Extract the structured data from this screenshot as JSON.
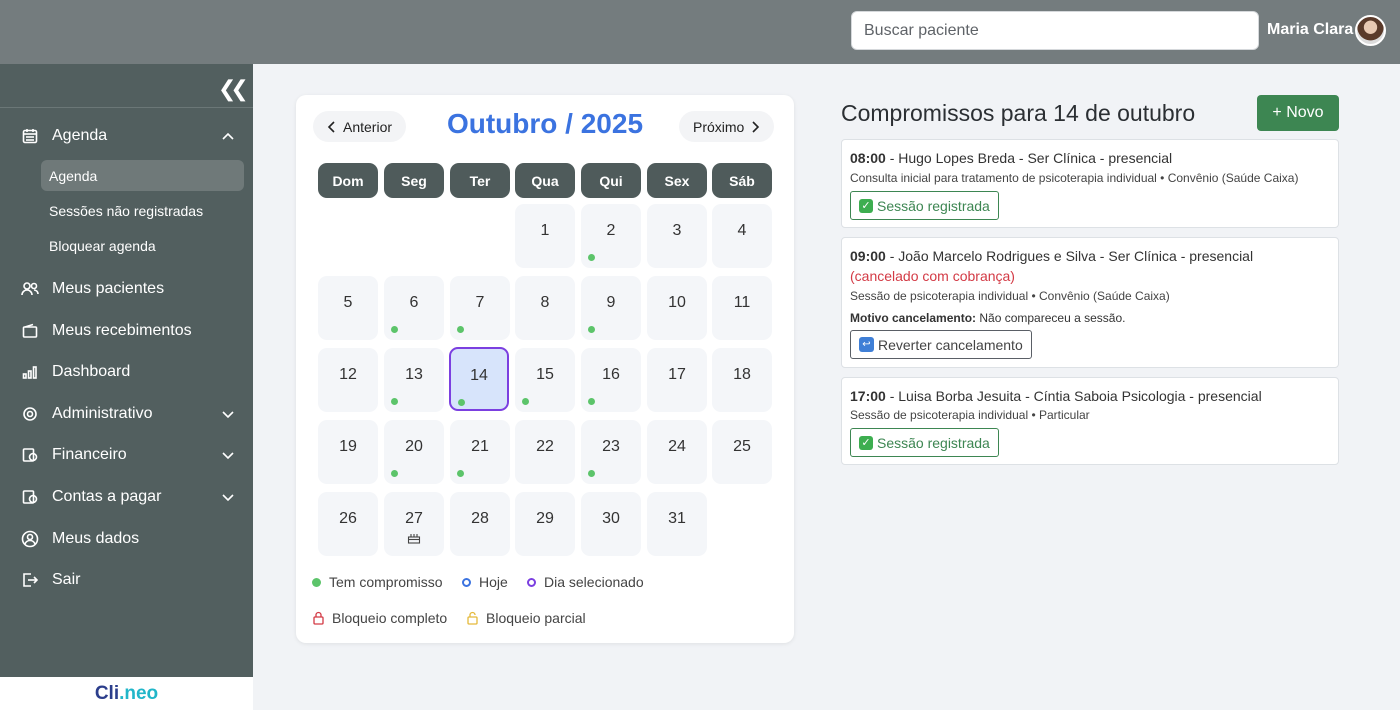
{
  "header": {
    "search_placeholder": "Buscar paciente",
    "user_name": "Maria Clara"
  },
  "sidebar": {
    "items": [
      {
        "label": "Agenda",
        "icon": "calendar-icon",
        "expanded": true
      },
      {
        "label": "Meus pacientes",
        "icon": "users-icon"
      },
      {
        "label": "Meus recebimentos",
        "icon": "wallet-icon"
      },
      {
        "label": "Dashboard",
        "icon": "bar-chart-icon"
      },
      {
        "label": "Administrativo",
        "icon": "gear-icon"
      },
      {
        "label": "Financeiro",
        "icon": "money-icon"
      },
      {
        "label": "Contas a pagar",
        "icon": "bill-icon"
      },
      {
        "label": "Meus dados",
        "icon": "user-circle-icon"
      },
      {
        "label": "Sair",
        "icon": "logout-icon"
      }
    ],
    "subitems": [
      {
        "label": "Agenda",
        "active": true
      },
      {
        "label": "Sessões não registradas"
      },
      {
        "label": "Bloquear agenda"
      }
    ],
    "brand_part1": "Cli",
    "brand_part2": ".neo"
  },
  "calendar": {
    "prev_label": "Anterior",
    "next_label": "Próximo",
    "title": "Outubro / 2025",
    "weekdays": [
      "Dom",
      "Seg",
      "Ter",
      "Qua",
      "Qui",
      "Sex",
      "Sáb"
    ],
    "first_weekday_index": 3,
    "days_in_month": 31,
    "selected_day": 14,
    "days_with_appointments": [
      2,
      6,
      7,
      9,
      13,
      14,
      15,
      16,
      20,
      21,
      23
    ],
    "birthday_days": [
      27
    ],
    "legend": {
      "has_appointment": "Tem compromisso",
      "today": "Hoje",
      "selected": "Dia selecionado",
      "full_block": "Bloqueio completo",
      "partial_block": "Bloqueio parcial"
    },
    "colors": {
      "appointment_dot": "#5cc46a",
      "today_ring": "#3b73e0",
      "selected_ring": "#7b3fe0",
      "full_block": "#d33a45",
      "partial_block": "#e5b93a"
    }
  },
  "appointments_panel": {
    "title": "Compromissos para 14 de outubro",
    "new_button": "+ Novo",
    "appointments": [
      {
        "time": "08:00",
        "title": " - Hugo Lopes Breda - Ser Clínica - presencial",
        "description": "Consulta inicial para tratamento de psicoterapia individual • Convênio (Saúde Caixa)",
        "button": "Sessão registrada"
      },
      {
        "time": "09:00",
        "title": " - João Marcelo Rodrigues e Silva - Ser Clínica - presencial",
        "status": "(cancelado com cobrança)",
        "description": "Sessão de psicoterapia individual • Convênio (Saúde Caixa)",
        "reason_label": "Motivo cancelamento:",
        "reason": " Não compareceu a sessão.",
        "button": "Reverter cancelamento"
      },
      {
        "time": "17:00",
        "title": " - Luisa Borba Jesuita - Cíntia Saboia Psicologia - presencial",
        "description": "Sessão de psicoterapia individual • Particular",
        "button": "Sessão registrada"
      }
    ]
  }
}
